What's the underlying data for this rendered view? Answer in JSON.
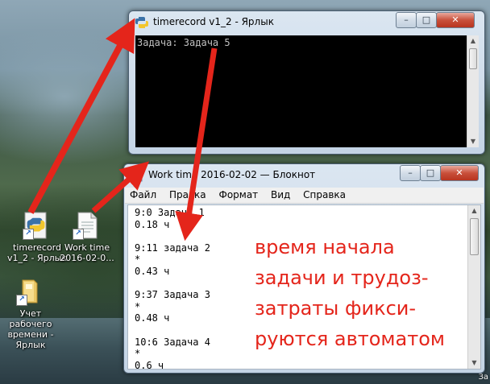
{
  "desktop": {
    "icons": [
      {
        "label_line1": "timerecord",
        "label_line2": "v1_2 - Ярлык",
        "icon": "python-icon"
      },
      {
        "label_line1": "Work time",
        "label_line2": "2016-02-0...",
        "icon": "text-file-icon"
      },
      {
        "label_line1": "Учет",
        "label_line2": "рабочего",
        "label_line3": "времени -",
        "label_line4": "Ярлык",
        "icon": "folder-icon"
      }
    ],
    "corner_text": "Зa"
  },
  "console_window": {
    "title": "timerecord v1_2 - Ярлык",
    "output": "Задача: Задача 5",
    "controls": [
      "–",
      "□",
      "✕"
    ]
  },
  "notepad_window": {
    "title": "Work time 2016-02-02 — Блокнот",
    "menu": [
      "Файл",
      "Правка",
      "Формат",
      "Вид",
      "Справка"
    ],
    "content": "9:0 Задача 1\n0.18 ч\n\n9:11 задача 2\n*\n0.43 ч\n\n9:37 Задача 3\n*\n0.48 ч\n\n10:6 Задача 4\n*\n0.6 ч",
    "controls": [
      "–",
      "□",
      "✕"
    ]
  },
  "annotation": {
    "text": "время начала\nзадачи и трудоз-\nзатраты фикси-\nруются автоматом",
    "color": "#e4251b"
  },
  "colors": {
    "arrow": "#e4251b",
    "console_bg": "#000000",
    "console_fg": "#c0c0c0"
  }
}
